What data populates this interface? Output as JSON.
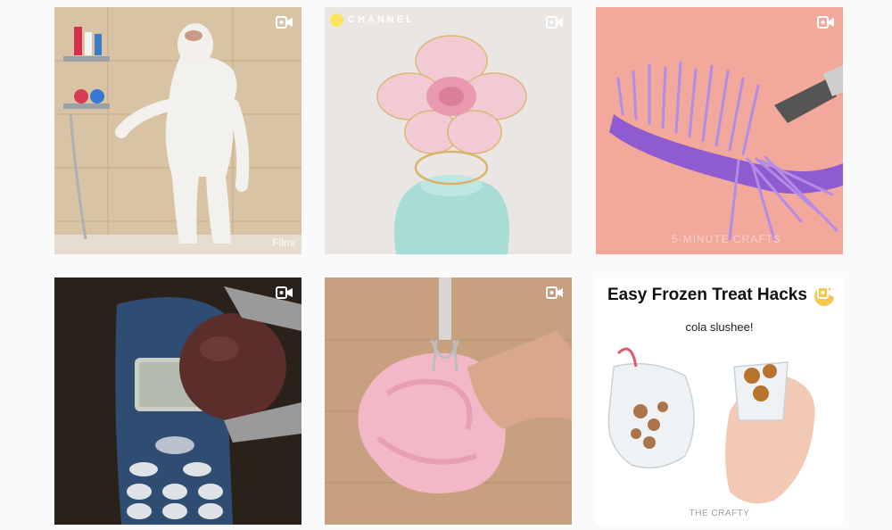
{
  "grid": {
    "posts": [
      {
        "type": "video",
        "icon": "video-camera-icon",
        "watermark": "Filmr"
      },
      {
        "type": "video",
        "icon": "video-camera-icon",
        "watermark": "CHANNEL"
      },
      {
        "type": "video",
        "icon": "video-camera-icon",
        "watermark": "5-MINUTE CRAFTS"
      },
      {
        "type": "video",
        "icon": "video-camera-icon"
      },
      {
        "type": "video",
        "icon": "video-camera-icon"
      },
      {
        "type": "video",
        "icon": "video-camera-icon",
        "title": "Easy Frozen Treat Hacks",
        "subtitle": "cola slushee!",
        "watermark": "THE CRAFTY"
      }
    ]
  },
  "colors": {
    "page_bg": "#fafafa",
    "icon": "#ffffff",
    "channel_dot": "#ffe35c"
  }
}
